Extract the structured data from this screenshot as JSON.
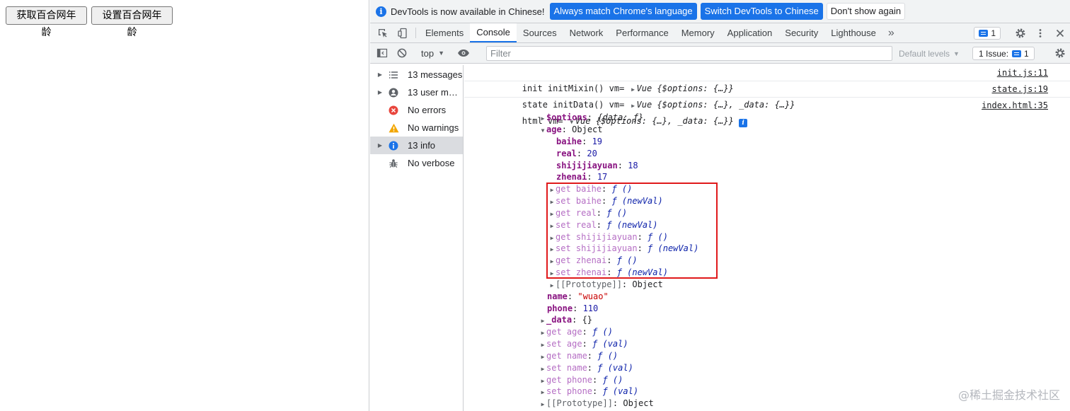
{
  "page": {
    "get_button": "获取百合网年龄",
    "set_button": "设置百合网年龄"
  },
  "infobar": {
    "message": "DevTools is now available in Chinese!",
    "match_language": "Always match Chrome's language",
    "switch_chinese": "Switch DevTools to Chinese",
    "dont_show": "Don't show again"
  },
  "tabs": [
    "Elements",
    "Console",
    "Sources",
    "Network",
    "Performance",
    "Memory",
    "Application",
    "Security",
    "Lighthouse"
  ],
  "tab_right": {
    "messages_count": "1"
  },
  "toolbar": {
    "context": "top",
    "filter_placeholder": "Filter",
    "levels": "Default levels",
    "issues": "1 Issue:",
    "issues_count": "1"
  },
  "sidebar": [
    {
      "label": "13 messages",
      "icon": "list-icon"
    },
    {
      "label": "13 user me…",
      "icon": "user-icon"
    },
    {
      "label": "No errors",
      "icon": "error-icon"
    },
    {
      "label": "No warnings",
      "icon": "warning-icon"
    },
    {
      "label": "13 info",
      "icon": "info-icon"
    },
    {
      "label": "No verbose",
      "icon": "bug-icon"
    }
  ],
  "console": {
    "line1": {
      "prefix": "init initMixin() vm= ",
      "obj": "Vue {$options: {…}}",
      "src": "init.js:11"
    },
    "line2": {
      "prefix": "state initData() vm= ",
      "obj": "Vue {$options: {…}, _data: {…}}",
      "src": "state.js:19"
    },
    "line3": {
      "prefix": "html vm= ",
      "obj": "Vue {$options: {…}, _data: {…}}",
      "src": "index.html:35",
      "info": "i"
    },
    "tree": {
      "options_key": "$options",
      "options_val": "{data: ƒ}",
      "age_key": "age",
      "age_val": "Object",
      "props": [
        {
          "k": "baihe",
          "v": "19"
        },
        {
          "k": "real",
          "v": "20"
        },
        {
          "k": "shijijiayuan",
          "v": "18"
        },
        {
          "k": "zhenai",
          "v": "17"
        }
      ],
      "accessors": [
        {
          "a": "get baihe",
          "f": "ƒ ()"
        },
        {
          "a": "set baihe",
          "f": "ƒ (newVal)"
        },
        {
          "a": "get real",
          "f": "ƒ ()"
        },
        {
          "a": "set real",
          "f": "ƒ (newVal)"
        },
        {
          "a": "get shijijiayuan",
          "f": "ƒ ()"
        },
        {
          "a": "set shijijiayuan",
          "f": "ƒ (newVal)"
        },
        {
          "a": "get zhenai",
          "f": "ƒ ()"
        },
        {
          "a": "set zhenai",
          "f": "ƒ (newVal)"
        }
      ],
      "proto_inner": "[[Prototype]]",
      "proto_val": "Object",
      "name_key": "name",
      "name_val": "\"wuao\"",
      "phone_key": "phone",
      "phone_val": "110",
      "data_key": "_data",
      "data_val": "{}",
      "outer_accessors": [
        {
          "a": "get age",
          "f": "ƒ ()"
        },
        {
          "a": "set age",
          "f": "ƒ (val)"
        },
        {
          "a": "get name",
          "f": "ƒ ()"
        },
        {
          "a": "set name",
          "f": "ƒ (val)"
        },
        {
          "a": "get phone",
          "f": "ƒ ()"
        },
        {
          "a": "set phone",
          "f": "ƒ (val)"
        }
      ],
      "proto_outer": "[[Prototype]]"
    }
  },
  "watermark": "@稀土掘金技术社区",
  "colors": {
    "accent": "#1a73e8",
    "highlight": "#e0191b"
  }
}
